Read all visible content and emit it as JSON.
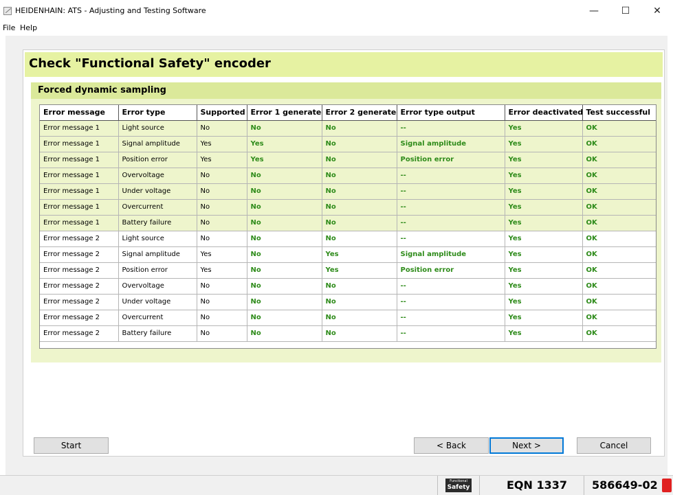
{
  "window": {
    "title": "HEIDENHAIN: ATS - Adjusting and Testing Software",
    "minimize_glyph": "—",
    "maximize_glyph": "☐",
    "close_glyph": "✕"
  },
  "menu": {
    "file": "File",
    "help": "Help"
  },
  "page": {
    "title": "Check \"Functional Safety\" encoder",
    "section_title": "Forced dynamic sampling"
  },
  "table": {
    "headers": [
      "Error message",
      "Error type",
      "Supported",
      "Error 1 generated",
      "Error 2 generated",
      "Error type output",
      "Error deactivated",
      "Test successful"
    ],
    "rows": [
      [
        "Error message 1",
        "Light source",
        "No",
        "No",
        "No",
        "--",
        "Yes",
        "OK"
      ],
      [
        "Error message 1",
        "Signal amplitude",
        "Yes",
        "Yes",
        "No",
        "Signal amplitude",
        "Yes",
        "OK"
      ],
      [
        "Error message 1",
        "Position error",
        "Yes",
        "Yes",
        "No",
        "Position error",
        "Yes",
        "OK"
      ],
      [
        "Error message 1",
        "Overvoltage",
        "No",
        "No",
        "No",
        "--",
        "Yes",
        "OK"
      ],
      [
        "Error message 1",
        "Under voltage",
        "No",
        "No",
        "No",
        "--",
        "Yes",
        "OK"
      ],
      [
        "Error message 1",
        "Overcurrent",
        "No",
        "No",
        "No",
        "--",
        "Yes",
        "OK"
      ],
      [
        "Error message 1",
        "Battery failure",
        "No",
        "No",
        "No",
        "--",
        "Yes",
        "OK"
      ],
      [
        "Error message 2",
        "Light source",
        "No",
        "No",
        "No",
        "--",
        "Yes",
        "OK"
      ],
      [
        "Error message 2",
        "Signal amplitude",
        "Yes",
        "No",
        "Yes",
        "Signal amplitude",
        "Yes",
        "OK"
      ],
      [
        "Error message 2",
        "Position error",
        "Yes",
        "No",
        "Yes",
        "Position error",
        "Yes",
        "OK"
      ],
      [
        "Error message 2",
        "Overvoltage",
        "No",
        "No",
        "No",
        "--",
        "Yes",
        "OK"
      ],
      [
        "Error message 2",
        "Under voltage",
        "No",
        "No",
        "No",
        "--",
        "Yes",
        "OK"
      ],
      [
        "Error message 2",
        "Overcurrent",
        "No",
        "No",
        "No",
        "--",
        "Yes",
        "OK"
      ],
      [
        "Error message 2",
        "Battery failure",
        "No",
        "No",
        "No",
        "--",
        "Yes",
        "OK"
      ]
    ]
  },
  "buttons": {
    "start": "Start",
    "back": "< Back",
    "next": "Next >",
    "cancel": "Cancel"
  },
  "status": {
    "logo_top": "Functional",
    "logo_bottom": "Safety",
    "model": "EQN 1337",
    "id": "586649-02"
  },
  "colors": {
    "header_band": "#e6f2a2",
    "section": "#eef5cc",
    "value_green": "#2e8b1a"
  }
}
